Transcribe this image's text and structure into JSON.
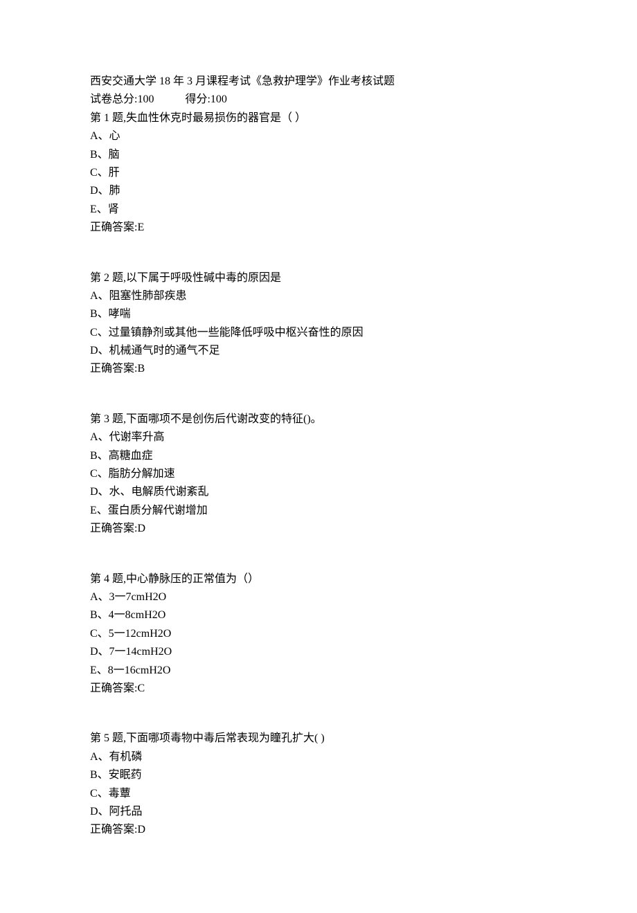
{
  "header": {
    "title": "西安交通大学 18 年 3 月课程考试《急救护理学》作业考核试题",
    "score_total_label": "试卷总分:100",
    "score_obtained_label": "得分:100"
  },
  "questions": [
    {
      "stem": "第 1 题,失血性休克时最易损伤的器官是（ ）",
      "options": [
        "A、心",
        "B、脑",
        "C、肝",
        "D、肺",
        "E、肾"
      ],
      "answer": "正确答案:E"
    },
    {
      "stem": "第 2 题,以下属于呼吸性碱中毒的原因是",
      "options": [
        "A、阻塞性肺部疾患",
        "B、哮喘",
        "C、过量镇静剂或其他一些能降低呼吸中枢兴奋性的原因",
        "D、机械通气时的通气不足"
      ],
      "answer": "正确答案:B"
    },
    {
      "stem": "第 3 题,下面哪项不是创伤后代谢改变的特征()。",
      "options": [
        "A、代谢率升高",
        "B、高糖血症",
        "C、脂肪分解加速",
        "D、水、电解质代谢紊乱",
        "E、蛋白质分解代谢增加"
      ],
      "answer": "正确答案:D"
    },
    {
      "stem": "第 4 题,中心静脉压的正常值为（）",
      "options": [
        "A、3一7cmH2O",
        "B、4一8cmH2O",
        "C、5一12cmH2O",
        "D、7一14cmH2O",
        "E、8一16cmH2O"
      ],
      "answer": "正确答案:C"
    },
    {
      "stem": "第 5 题,下面哪项毒物中毒后常表现为瞳孔扩大(       )",
      "options": [
        "A、有机磷",
        "B、安眠药",
        "C、毒蕈",
        "D、阿托品"
      ],
      "answer": "正确答案:D"
    }
  ]
}
